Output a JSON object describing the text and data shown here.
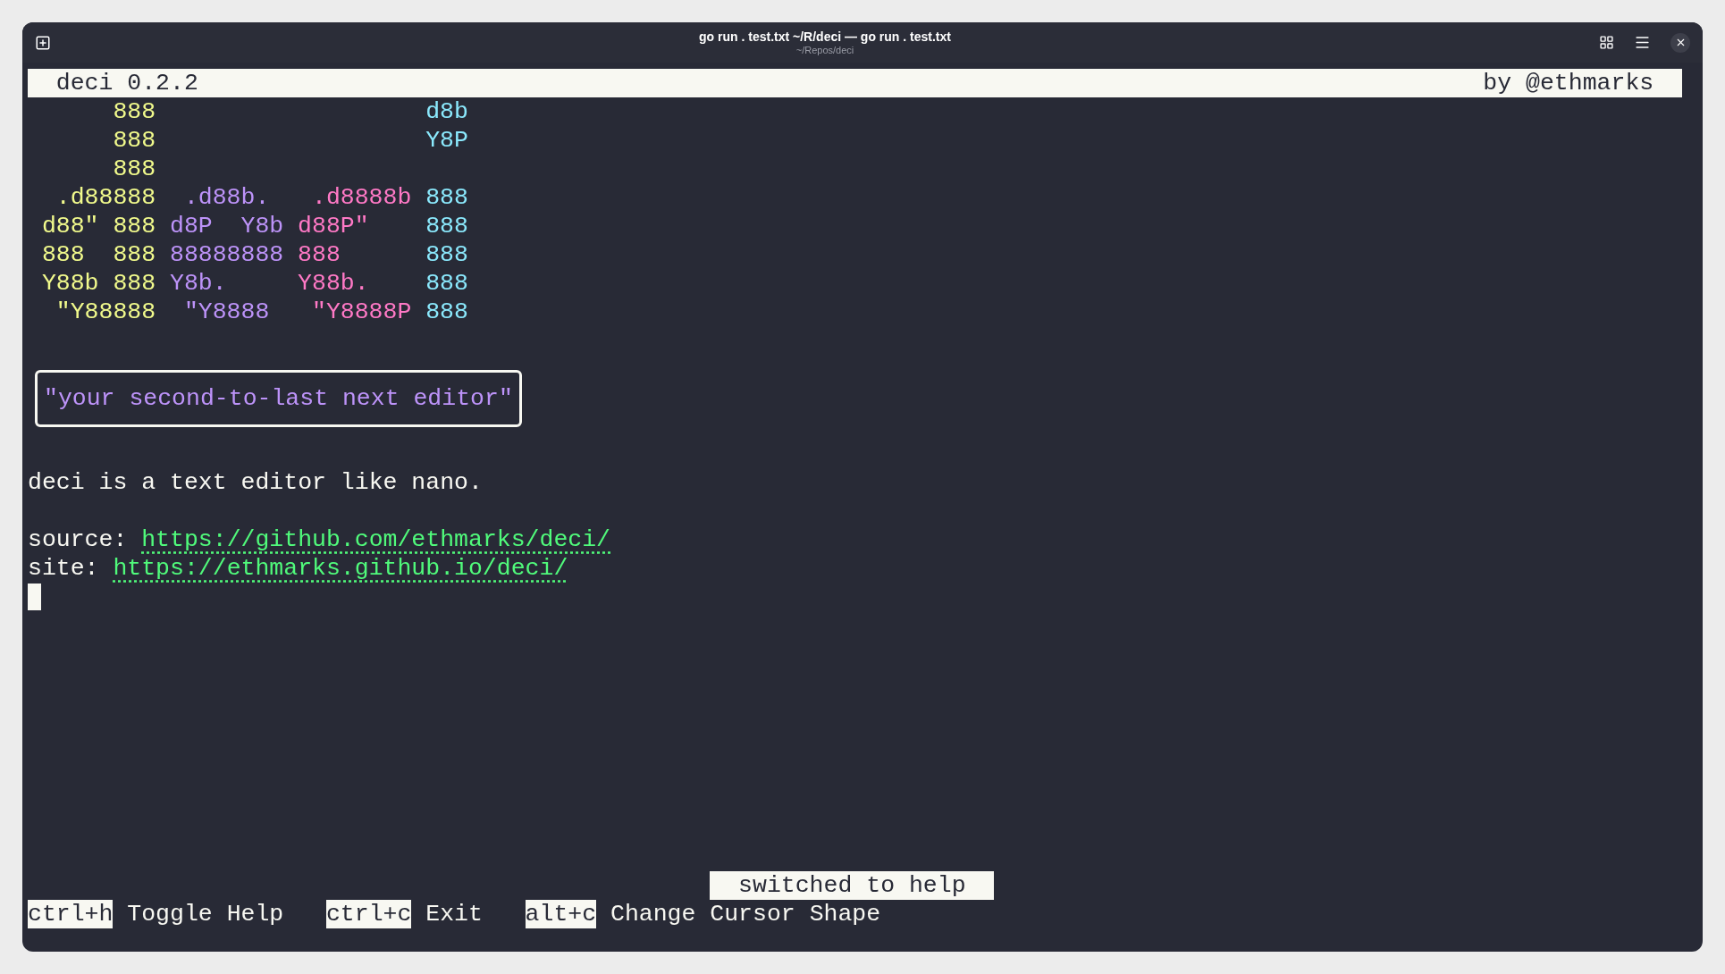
{
  "window": {
    "title": "go run . test.txt ~/R/deci — go run . test.txt",
    "subtitle": "~/Repos/deci"
  },
  "header": {
    "app": "deci 0.2.2",
    "author": "by @ethmarks"
  },
  "art": {
    "rows": [
      [
        {
          "text": "888",
          "color": "#f1fa8c"
        },
        null,
        null,
        {
          "text": "d8b",
          "color": "#8be9fd"
        }
      ],
      [
        {
          "text": "888",
          "color": "#f1fa8c"
        },
        null,
        null,
        {
          "text": "Y8P",
          "color": "#8be9fd"
        }
      ],
      [
        {
          "text": "888",
          "color": "#f1fa8c"
        },
        null,
        null,
        null
      ],
      [
        {
          "text": ".d88888",
          "color": "#f1fa8c"
        },
        {
          "text": " .d88b.",
          "color": "#bd93f9"
        },
        {
          "text": " .d8888b",
          "color": "#ff79c6"
        },
        {
          "text": "888",
          "color": "#8be9fd"
        }
      ],
      [
        {
          "text": "d88\" 888",
          "color": "#f1fa8c"
        },
        {
          "text": "d8P  Y8b",
          "color": "#bd93f9"
        },
        {
          "text": "d88P\"",
          "color": "#ff79c6"
        },
        {
          "text": "888",
          "color": "#8be9fd"
        }
      ],
      [
        {
          "text": "888  888",
          "color": "#f1fa8c"
        },
        {
          "text": "88888888",
          "color": "#bd93f9"
        },
        {
          "text": "888",
          "color": "#ff79c6"
        },
        {
          "text": "888",
          "color": "#8be9fd"
        }
      ],
      [
        {
          "text": "Y88b 888",
          "color": "#f1fa8c"
        },
        {
          "text": "Y8b.",
          "color": "#bd93f9"
        },
        {
          "text": "Y88b.",
          "color": "#ff79c6"
        },
        {
          "text": "888",
          "color": "#8be9fd"
        }
      ],
      [
        {
          "text": "\"Y88888",
          "color": "#f1fa8c"
        },
        {
          "text": " \"Y8888",
          "color": "#bd93f9"
        },
        {
          "text": " \"Y8888P",
          "color": "#ff79c6"
        },
        {
          "text": "888",
          "color": "#8be9fd"
        }
      ]
    ]
  },
  "tagline": "\"your second-to-last next editor\"",
  "description": "deci is a text editor like nano.",
  "links": [
    {
      "label": "source:",
      "url": "https://github.com/ethmarks/deci/"
    },
    {
      "label": "site:",
      "url": "https://ethmarks.github.io/deci/"
    }
  ],
  "status": "switched to help",
  "shortcuts": [
    {
      "key": "ctrl+h",
      "action": "Toggle Help"
    },
    {
      "key": "ctrl+c",
      "action": "Exit"
    },
    {
      "key": "alt+c",
      "action": "Change Cursor Shape"
    }
  ]
}
